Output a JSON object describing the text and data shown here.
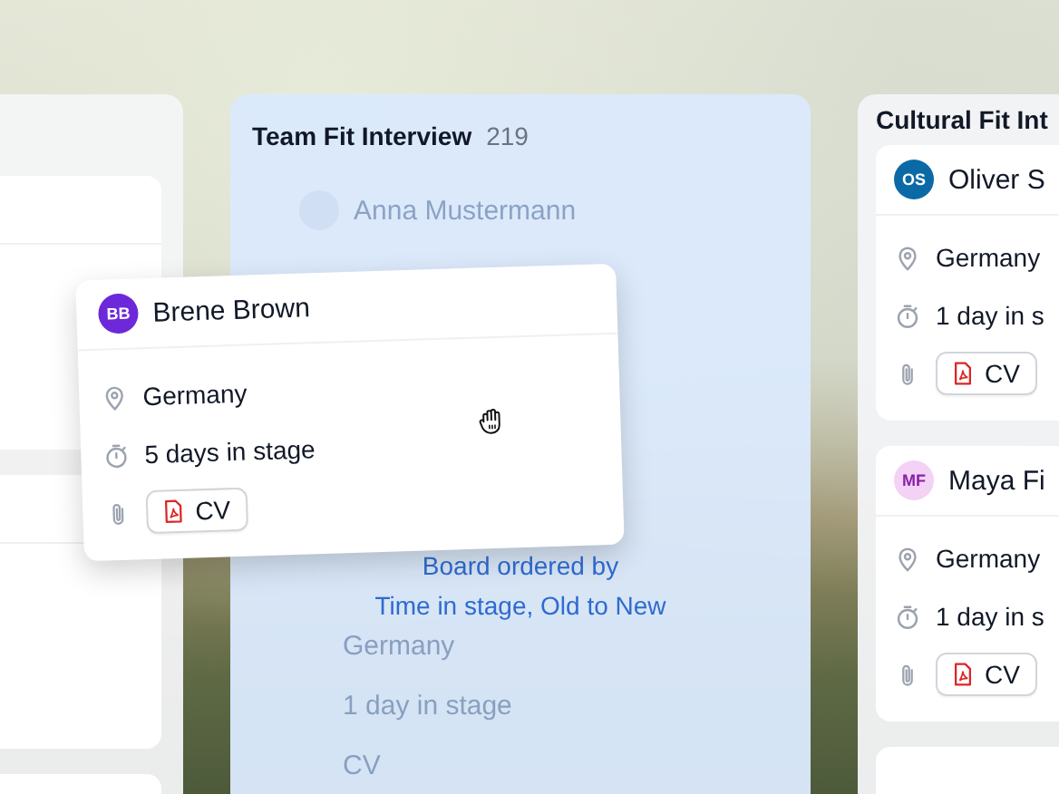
{
  "middle_column": {
    "title": "Team Fit Interview",
    "count": "219",
    "faded_cards": [
      {
        "name": "Anna Mustermann"
      },
      {
        "location": "Germany",
        "time_in_stage": "1 day in stage",
        "attachment": "CV"
      }
    ],
    "sort_note": [
      "Board ordered by",
      "Time in stage, Old to New"
    ]
  },
  "dragged_card": {
    "initials": "BB",
    "name": "Brene Brown",
    "color": "#6d28d9",
    "location": "Germany",
    "time_in_stage": "5 days in stage",
    "attachment": "CV"
  },
  "right_column": {
    "title": "Cultural Fit Int",
    "cards": [
      {
        "initials": "OS",
        "name": "Oliver S",
        "color": "#0b6aa6",
        "location": "Germany",
        "time_in_stage": "1 day in s",
        "attachment": "CV"
      },
      {
        "initials": "MF",
        "name": "Maya Fi",
        "color": "#f3d2f5",
        "location": "Germany",
        "time_in_stage": "1 day in s",
        "attachment": "CV"
      }
    ]
  }
}
